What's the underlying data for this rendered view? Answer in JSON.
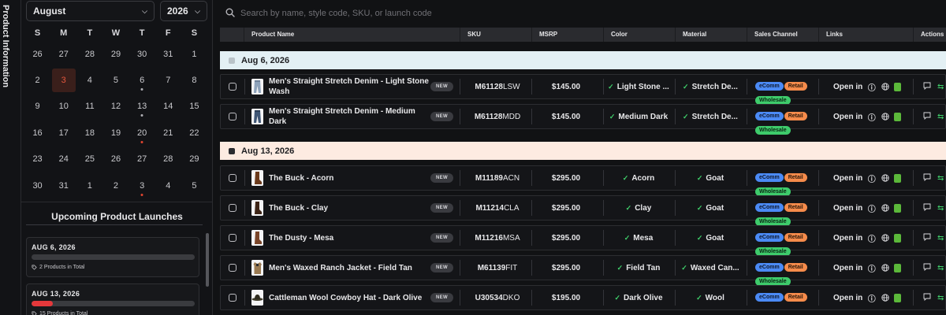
{
  "side_tab": {
    "label": "Product Information"
  },
  "calendar": {
    "month": "August",
    "year": "2026",
    "weekdays": [
      "S",
      "M",
      "T",
      "W",
      "T",
      "F",
      "S"
    ],
    "weeks": [
      [
        {
          "d": "26"
        },
        {
          "d": "27"
        },
        {
          "d": "28"
        },
        {
          "d": "29"
        },
        {
          "d": "30"
        },
        {
          "d": "31"
        },
        {
          "d": "1"
        }
      ],
      [
        {
          "d": "2"
        },
        {
          "d": "3",
          "today": true
        },
        {
          "d": "4"
        },
        {
          "d": "5"
        },
        {
          "d": "6",
          "dot": "gray"
        },
        {
          "d": "7"
        },
        {
          "d": "8"
        }
      ],
      [
        {
          "d": "9"
        },
        {
          "d": "10"
        },
        {
          "d": "11"
        },
        {
          "d": "12"
        },
        {
          "d": "13",
          "dot": "gray"
        },
        {
          "d": "14"
        },
        {
          "d": "15"
        }
      ],
      [
        {
          "d": "16"
        },
        {
          "d": "17"
        },
        {
          "d": "18"
        },
        {
          "d": "19"
        },
        {
          "d": "20",
          "dot": "red"
        },
        {
          "d": "21"
        },
        {
          "d": "22"
        }
      ],
      [
        {
          "d": "23"
        },
        {
          "d": "24"
        },
        {
          "d": "25"
        },
        {
          "d": "26"
        },
        {
          "d": "27"
        },
        {
          "d": "28"
        },
        {
          "d": "29"
        }
      ],
      [
        {
          "d": "30"
        },
        {
          "d": "31"
        },
        {
          "d": "1"
        },
        {
          "d": "2"
        },
        {
          "d": "3",
          "dot": "red"
        },
        {
          "d": "4"
        },
        {
          "d": "5"
        }
      ]
    ]
  },
  "upcoming": {
    "title": "Upcoming Product Launches",
    "items": [
      {
        "date": "AUG 6, 2026",
        "count": "2 Products in Total",
        "progress": 0
      },
      {
        "date": "AUG 13, 2026",
        "count": "15 Products in Total",
        "progress": 0.13
      }
    ]
  },
  "search": {
    "placeholder": "Search by name, style code, SKU, or launch code"
  },
  "columns": [
    "Product Name",
    "SKU",
    "MSRP",
    "Color",
    "Material",
    "Sales Channel",
    "Links",
    "Actions"
  ],
  "groups": [
    {
      "label": "Aug 6, 2026",
      "bg": "#e3f0f4",
      "sq": "#b9c3c8"
    },
    {
      "label": "Aug 13, 2026",
      "bg": "#fdebe1",
      "sq": "#2a2b2f"
    }
  ],
  "badges": {
    "new": "NEW",
    "open_in": "Open in"
  },
  "colors": {
    "ecomm": "#4b8af5",
    "retail": "#f58b4b",
    "wholesale": "#3ecb6b",
    "accent": "#e5383b"
  },
  "rows": [
    {
      "name": "Men's Straight Stretch Denim - Light Stone Wash",
      "sku_bold": "M61128",
      "sku_rest": "LSW",
      "msrp": "$145.00",
      "color": "Light Stone ...",
      "material": "Stretch De...",
      "channels": [
        "eComm",
        "Retail",
        "Wholesale"
      ],
      "thumb": "jeans-light"
    },
    {
      "name": "Men's Straight Stretch Denim - Medium Dark",
      "sku_bold": "M61128",
      "sku_rest": "MDD",
      "msrp": "$145.00",
      "color": "Medium Dark",
      "material": "Stretch De...",
      "channels": [
        "eComm",
        "Retail",
        "Wholesale"
      ],
      "thumb": "jeans-dark"
    },
    {
      "name": "The Buck - Acorn",
      "sku_bold": "M11189",
      "sku_rest": "ACN",
      "msrp": "$295.00",
      "color": "Acorn",
      "material": "Goat",
      "channels": [
        "eComm",
        "Retail",
        "Wholesale"
      ],
      "thumb": "boot-brown"
    },
    {
      "name": "The Buck - Clay",
      "sku_bold": "M11214",
      "sku_rest": "CLA",
      "msrp": "$295.00",
      "color": "Clay",
      "material": "Goat",
      "channels": [
        "eComm",
        "Retail",
        "Wholesale"
      ],
      "thumb": "boot-dark"
    },
    {
      "name": "The Dusty - Mesa",
      "sku_bold": "M11216",
      "sku_rest": "MSA",
      "msrp": "$295.00",
      "color": "Mesa",
      "material": "Goat",
      "channels": [
        "eComm",
        "Retail",
        "Wholesale"
      ],
      "thumb": "boot-mesa"
    },
    {
      "name": "Men's Waxed Ranch Jacket - Field Tan",
      "sku_bold": "M61139",
      "sku_rest": "FIT",
      "msrp": "$295.00",
      "color": "Field Tan",
      "material": "Waxed Can...",
      "channels": [
        "eComm",
        "Retail",
        "Wholesale"
      ],
      "thumb": "jacket"
    },
    {
      "name": "Cattleman Wool Cowboy Hat - Dark Olive",
      "sku_bold": "U30534",
      "sku_rest": "DKO",
      "msrp": "$195.00",
      "color": "Dark Olive",
      "material": "Wool",
      "channels": [
        "eComm",
        "Retail"
      ],
      "thumb": "hat"
    }
  ]
}
